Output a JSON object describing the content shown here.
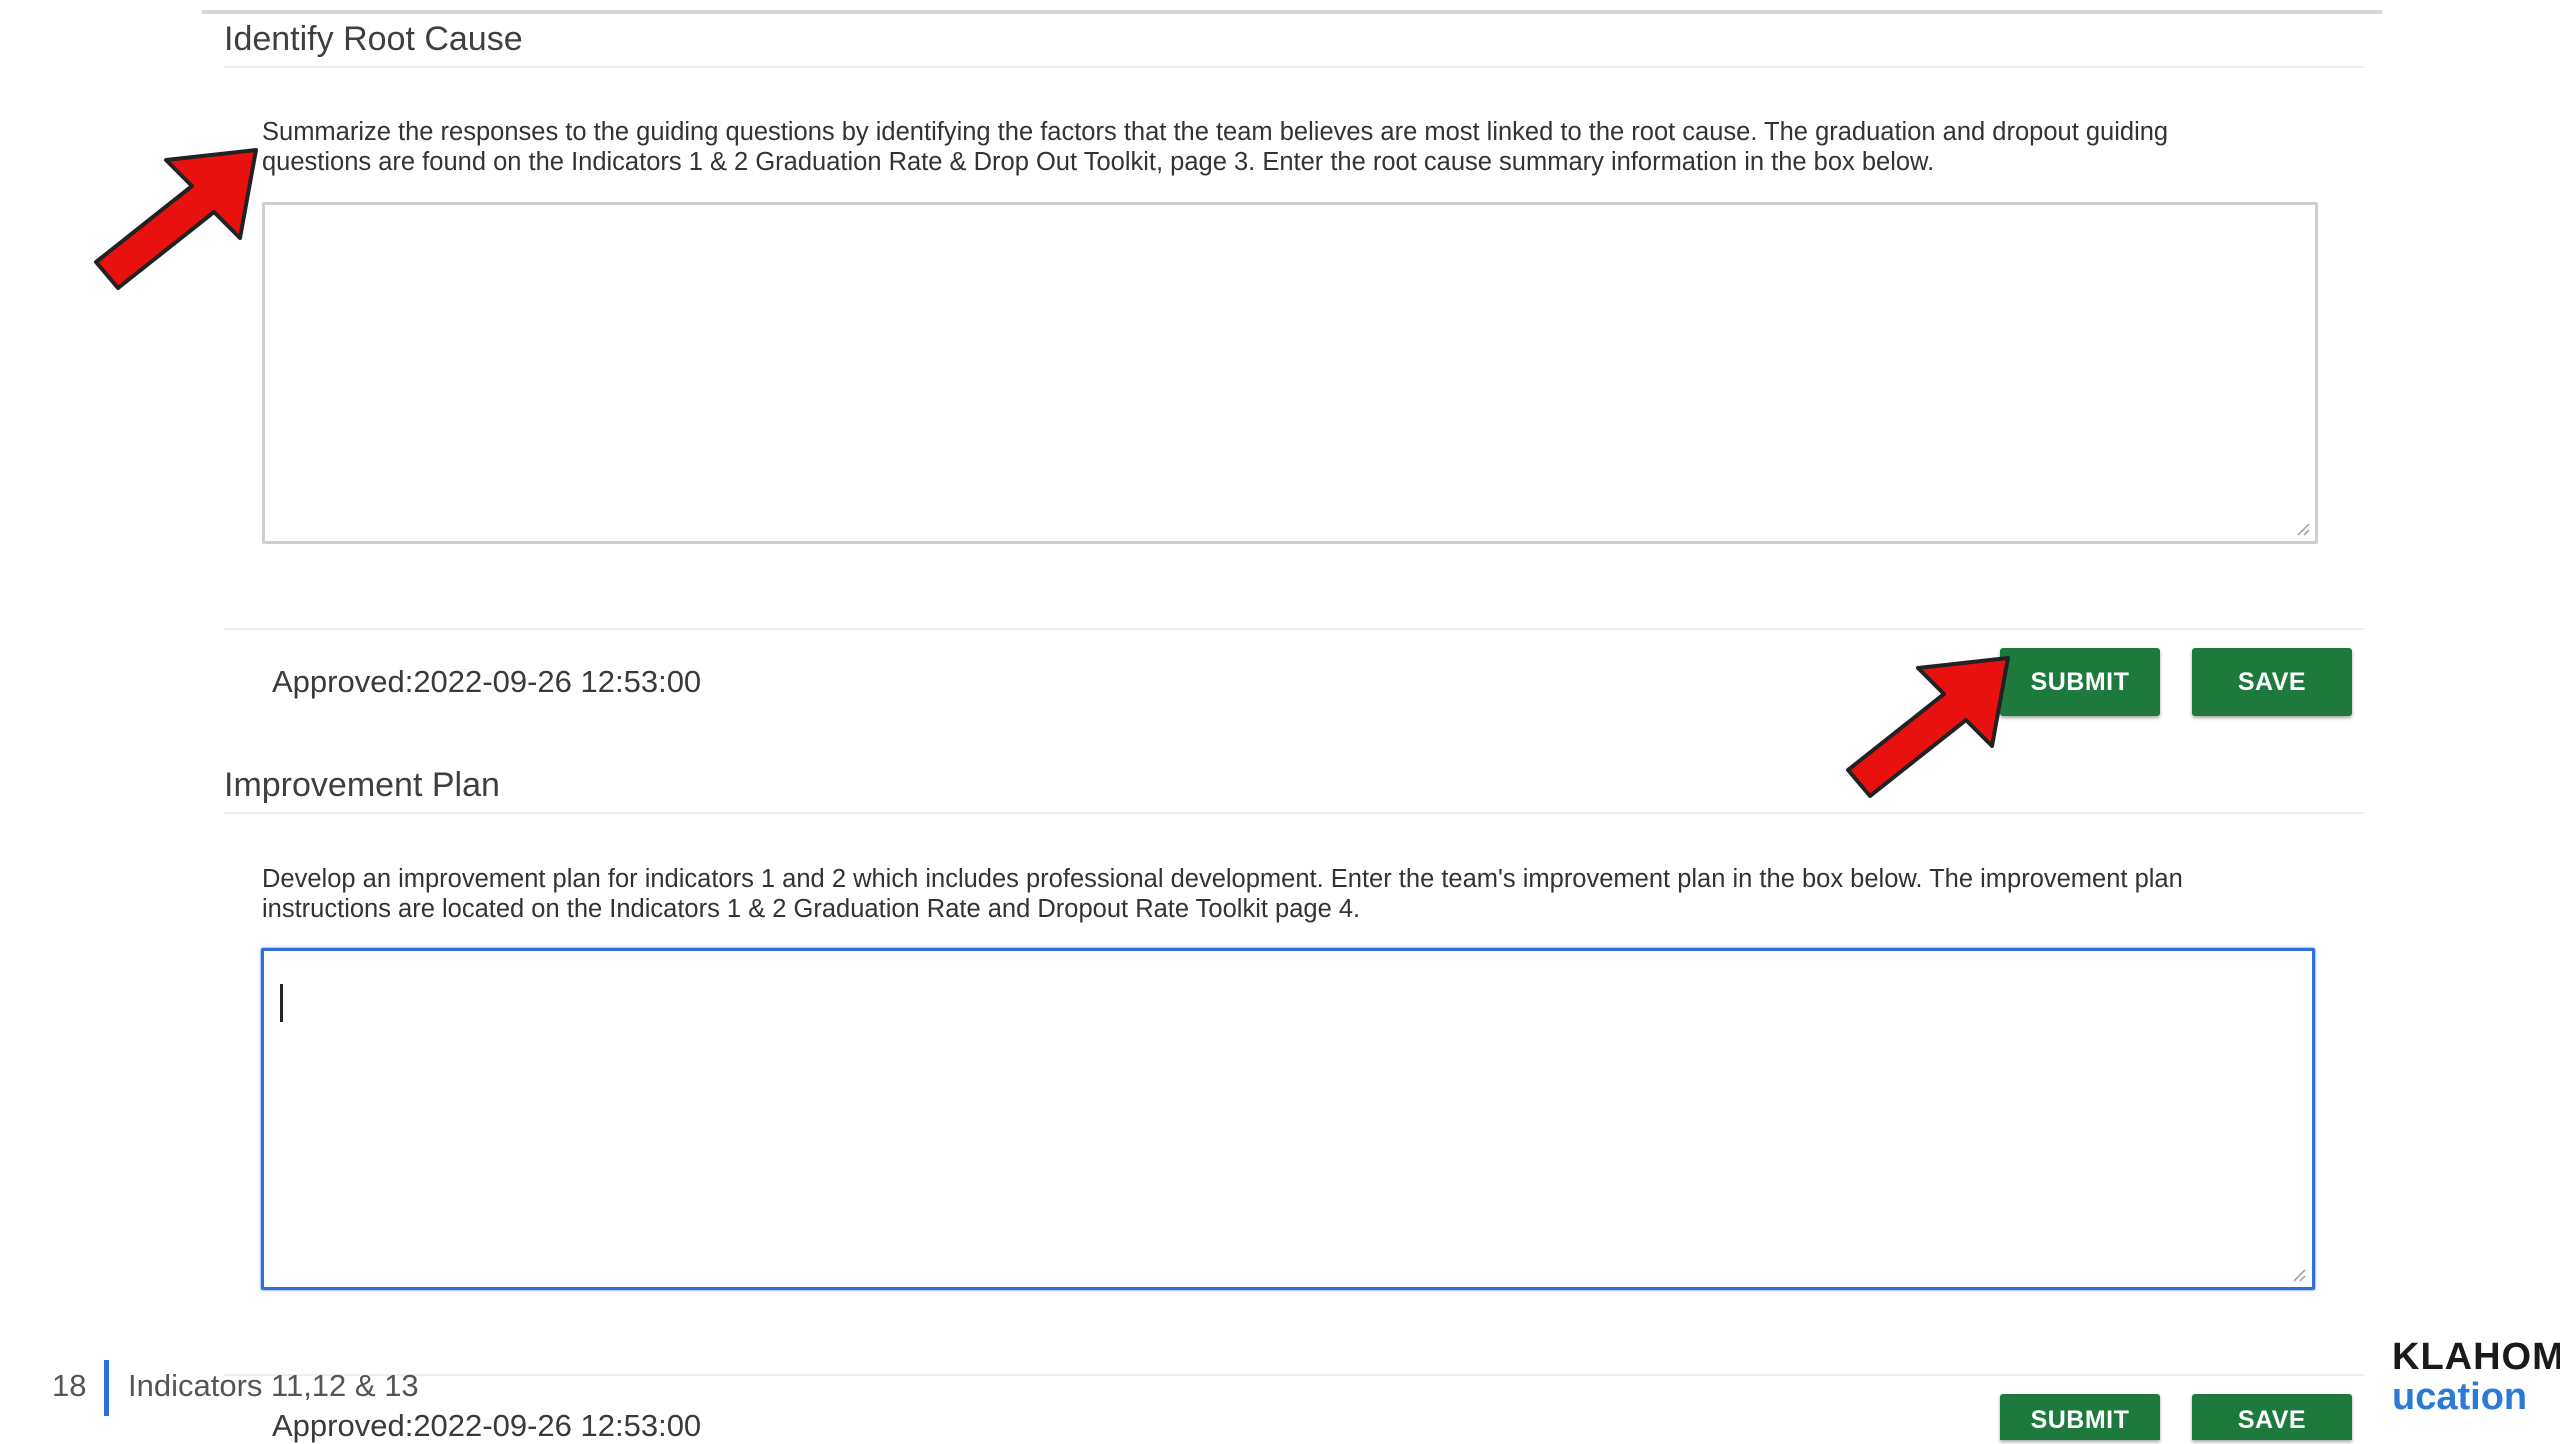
{
  "root_cause": {
    "title": "Identify Root Cause",
    "instructions": "Summarize the responses to the guiding questions by identifying the factors that the team believes are most linked to the root cause. The graduation and dropout guiding\nquestions are found on the Indicators 1 & 2 Graduation Rate & Drop Out Toolkit, page 3. Enter the root cause summary information in the box below.",
    "textarea_value": "",
    "status": "Approved:2022-09-26 12:53:00",
    "submit_label": "SUBMIT",
    "save_label": "SAVE"
  },
  "improvement_plan": {
    "title": "Improvement Plan",
    "instructions": "Develop an improvement plan for indicators 1 and 2 which includes professional development. Enter the team's improvement plan in the box below. The improvement plan\ninstructions are located on the Indicators 1 & 2 Graduation Rate and Dropout Rate Toolkit page 4.",
    "textarea_value": "",
    "status": "Approved:2022-09-26 12:53:00",
    "submit_label": "SUBMIT",
    "save_label": "SAVE"
  },
  "footer": {
    "page_number": "18",
    "text": "Indicators 11,12 & 13",
    "logo_line1": "KLAHOMA",
    "logo_line2": "ucation"
  },
  "colors": {
    "button_green": "#1e7a3c",
    "arrow_red": "#e8110f",
    "focus_blue": "#2f6fe0",
    "footer_bar_blue": "#2b6fd6"
  },
  "icons": {
    "annotation_arrow": "red-arrow-icon",
    "resize_grip": "resize-grip-icon"
  }
}
